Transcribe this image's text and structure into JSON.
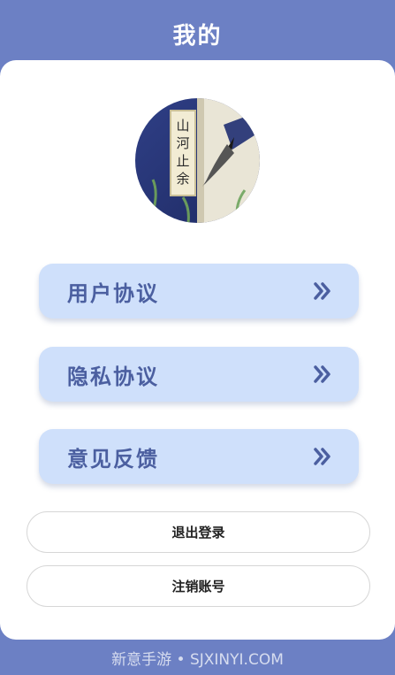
{
  "header": {
    "title": "我的"
  },
  "avatar": {
    "alt": "avatar",
    "calligraphy_text": [
      "山",
      "河",
      "止",
      "余"
    ]
  },
  "menu": {
    "items": [
      {
        "label": "用户协议",
        "icon": "double-chevron-right-icon"
      },
      {
        "label": "隐私协议",
        "icon": "double-chevron-right-icon"
      },
      {
        "label": "意见反馈",
        "icon": "double-chevron-right-icon"
      }
    ]
  },
  "actions": {
    "logout_label": "退出登录",
    "cancel_account_label": "注销账号"
  },
  "watermark": {
    "text": "新意手游 • SJXINYI.COM"
  },
  "colors": {
    "header_bg": "#6c80c4",
    "menu_bg": "#cfe0fb",
    "menu_text": "#4b5fa0",
    "card_bg": "#ffffff"
  }
}
